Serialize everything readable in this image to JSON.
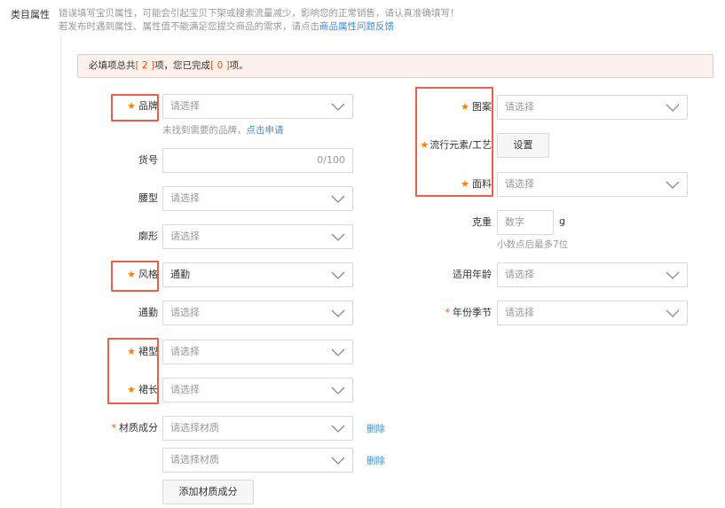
{
  "section_label": "类目属性",
  "warning": {
    "line1": "错误填写宝贝属性，可能会引起宝贝下架或搜索流量减少，影响您的正常销售，请认真准确填写！",
    "line2_prefix": "若发布时遇到属性、属性值不能满足您提交商品的需求，请点击",
    "line2_link": "商品属性问题反馈"
  },
  "alert": {
    "prefix": "必填项总共",
    "total": "[ 2 ]",
    "mid": "项，您已完成",
    "done": "[ 0 ]",
    "suffix": "项。"
  },
  "left": {
    "brand": {
      "label": "品牌",
      "placeholder": "请选择"
    },
    "brand_hint": {
      "text": "未找到需要的品牌，",
      "link": "点击申请"
    },
    "item_no": {
      "label": "货号",
      "counter": "0/100"
    },
    "waist": {
      "label": "腰型",
      "placeholder": "请选择"
    },
    "silhouette": {
      "label": "廓形",
      "placeholder": "请选择"
    },
    "style": {
      "label": "风格",
      "value": "通勤"
    },
    "commute": {
      "label": "通勤",
      "placeholder": "请选择"
    },
    "skirt_type": {
      "label": "裙型",
      "placeholder": "请选择"
    },
    "skirt_length": {
      "label": "裙长",
      "placeholder": "请选择"
    },
    "material": {
      "label": "材质成分",
      "placeholder": "请选择材质",
      "delete": "删除"
    },
    "add_material": "添加材质成分"
  },
  "right": {
    "pattern": {
      "label": "图案",
      "placeholder": "请选择"
    },
    "trend": {
      "label": "流行元素/工艺",
      "button": "设置"
    },
    "fabric": {
      "label": "面料",
      "placeholder": "请选择"
    },
    "weight": {
      "label": "克重",
      "placeholder": "数字",
      "unit": "g",
      "hint": "小数点后最多7位"
    },
    "age": {
      "label": "适用年龄",
      "placeholder": "请选择"
    },
    "season": {
      "label": "年份季节",
      "placeholder": "请选择"
    }
  },
  "colors": {
    "required_star": "#ff7d00",
    "highlight_box": "#e8604c",
    "link": "#3d8fd6"
  }
}
